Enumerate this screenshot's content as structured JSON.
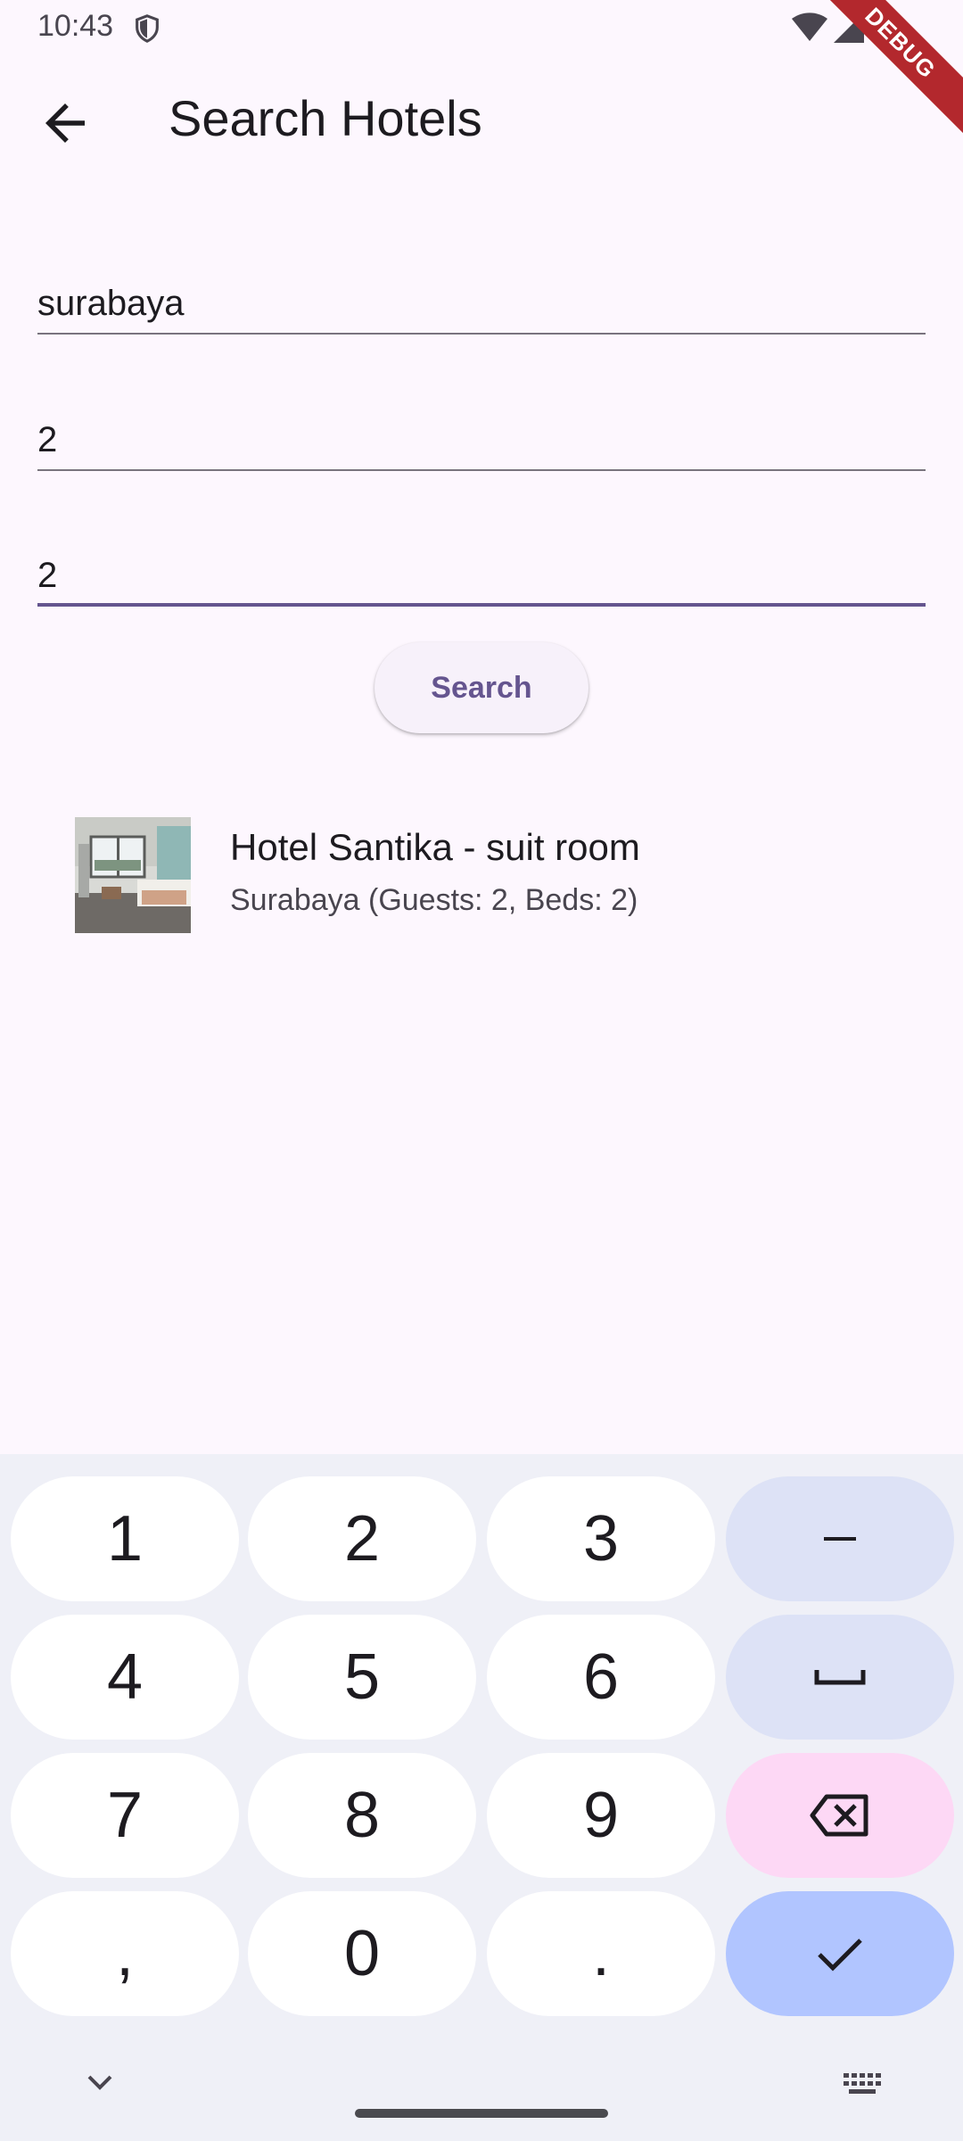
{
  "status": {
    "time": "10:43",
    "debug_label": "DEBUG"
  },
  "appbar": {
    "title": "Search Hotels"
  },
  "form": {
    "location": "surabaya",
    "guests": "2",
    "beds": "2",
    "search_label": "Search"
  },
  "results": [
    {
      "title": "Hotel Santika - suit room",
      "subtitle": "Surabaya (Guests: 2, Beds: 2)"
    }
  ],
  "keyboard": {
    "keys": [
      "1",
      "2",
      "3",
      "–",
      "4",
      "5",
      "6",
      "␣",
      "7",
      "8",
      "9",
      "⌫",
      ",",
      "0",
      ".",
      "✓"
    ]
  },
  "colors": {
    "accent": "#65558f",
    "background": "#fdf7fe",
    "keyboard": "#eff0f7"
  }
}
